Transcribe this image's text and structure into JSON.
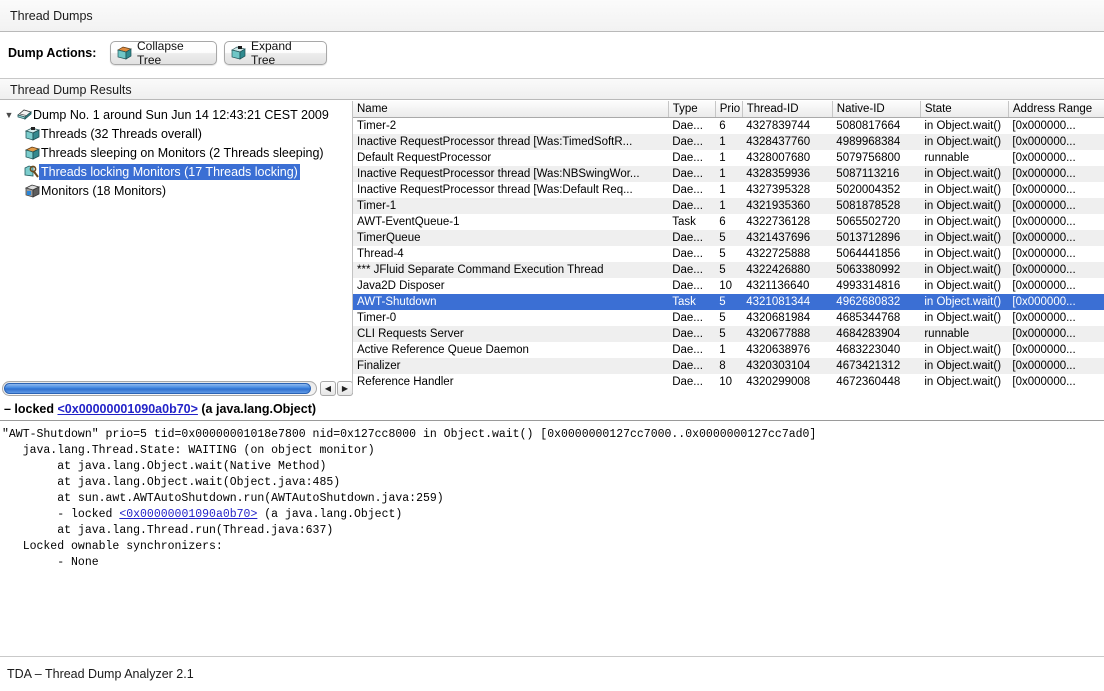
{
  "window": {
    "title": "Thread Dumps"
  },
  "toolbar": {
    "label": "Dump Actions:",
    "collapse_label": "Collapse Tree",
    "expand_label": "Expand Tree"
  },
  "results_panel": {
    "header": "Thread Dump Results"
  },
  "tree": {
    "nodes": [
      {
        "label": "Dump No. 1 around Sun Jun 14 12:43:21 CEST 2009",
        "icon": "dump-icon",
        "expanded": true,
        "twisty": "▼",
        "depth": 0,
        "selected": false
      },
      {
        "label": "Threads (32 Threads overall)",
        "icon": "threads-icon",
        "twisty": "",
        "depth": 1,
        "selected": false
      },
      {
        "label": "Threads sleeping on Monitors (2 Threads sleeping)",
        "icon": "sleeping-icon",
        "twisty": "",
        "depth": 1,
        "selected": false
      },
      {
        "label": "Threads locking Monitors (17 Threads locking)",
        "icon": "locking-icon",
        "twisty": "",
        "depth": 1,
        "selected": true
      },
      {
        "label": "Monitors (18 Monitors)",
        "icon": "monitors-icon",
        "twisty": "",
        "depth": 1,
        "selected": false
      }
    ]
  },
  "scrollbar": {
    "left_arrow": "◀",
    "right_arrow": "▶"
  },
  "table": {
    "columns": [
      "Name",
      "Type",
      "Prio",
      "Thread-ID",
      "Native-ID",
      "State",
      "Address Range"
    ],
    "rows": [
      {
        "name": "Timer-2",
        "type": "Dae...",
        "prio": "6",
        "tid": "4327839744",
        "nid": "5080817664",
        "state": "in Object.wait()",
        "addr": "[0x000000...",
        "selected": false
      },
      {
        "name": "Inactive RequestProcessor thread [Was:TimedSoftR...",
        "type": "Dae...",
        "prio": "1",
        "tid": "4328437760",
        "nid": "4989968384",
        "state": "in Object.wait()",
        "addr": "[0x000000...",
        "selected": false
      },
      {
        "name": "Default RequestProcessor",
        "type": "Dae...",
        "prio": "1",
        "tid": "4328007680",
        "nid": "5079756800",
        "state": "runnable",
        "addr": "[0x000000...",
        "selected": false
      },
      {
        "name": "Inactive RequestProcessor thread [Was:NBSwingWor...",
        "type": "Dae...",
        "prio": "1",
        "tid": "4328359936",
        "nid": "5087113216",
        "state": "in Object.wait()",
        "addr": "[0x000000...",
        "selected": false
      },
      {
        "name": "Inactive RequestProcessor thread [Was:Default Req...",
        "type": "Dae...",
        "prio": "1",
        "tid": "4327395328",
        "nid": "5020004352",
        "state": "in Object.wait()",
        "addr": "[0x000000...",
        "selected": false
      },
      {
        "name": "Timer-1",
        "type": "Dae...",
        "prio": "1",
        "tid": "4321935360",
        "nid": "5081878528",
        "state": "in Object.wait()",
        "addr": "[0x000000...",
        "selected": false
      },
      {
        "name": "AWT-EventQueue-1",
        "type": "Task",
        "prio": "6",
        "tid": "4322736128",
        "nid": "5065502720",
        "state": "in Object.wait()",
        "addr": "[0x000000...",
        "selected": false
      },
      {
        "name": "TimerQueue",
        "type": "Dae...",
        "prio": "5",
        "tid": "4321437696",
        "nid": "5013712896",
        "state": "in Object.wait()",
        "addr": "[0x000000...",
        "selected": false
      },
      {
        "name": "Thread-4",
        "type": "Dae...",
        "prio": "5",
        "tid": "4322725888",
        "nid": "5064441856",
        "state": "in Object.wait()",
        "addr": "[0x000000...",
        "selected": false
      },
      {
        "name": "*** JFluid Separate Command Execution Thread",
        "type": "Dae...",
        "prio": "5",
        "tid": "4322426880",
        "nid": "5063380992",
        "state": "in Object.wait()",
        "addr": "[0x000000...",
        "selected": false
      },
      {
        "name": "Java2D Disposer",
        "type": "Dae...",
        "prio": "10",
        "tid": "4321136640",
        "nid": "4993314816",
        "state": "in Object.wait()",
        "addr": "[0x000000...",
        "selected": false
      },
      {
        "name": "AWT-Shutdown",
        "type": "Task",
        "prio": "5",
        "tid": "4321081344",
        "nid": "4962680832",
        "state": "in Object.wait()",
        "addr": "[0x000000...",
        "selected": true
      },
      {
        "name": "Timer-0",
        "type": "Dae...",
        "prio": "5",
        "tid": "4320681984",
        "nid": "4685344768",
        "state": "in Object.wait()",
        "addr": "[0x000000...",
        "selected": false
      },
      {
        "name": "CLI Requests Server",
        "type": "Dae...",
        "prio": "5",
        "tid": "4320677888",
        "nid": "4684283904",
        "state": "runnable",
        "addr": "[0x000000...",
        "selected": false
      },
      {
        "name": "Active Reference Queue Daemon",
        "type": "Dae...",
        "prio": "1",
        "tid": "4320638976",
        "nid": "4683223040",
        "state": "in Object.wait()",
        "addr": "[0x000000...",
        "selected": false
      },
      {
        "name": "Finalizer",
        "type": "Dae...",
        "prio": "8",
        "tid": "4320303104",
        "nid": "4673421312",
        "state": "in Object.wait()",
        "addr": "[0x000000...",
        "selected": false
      },
      {
        "name": "Reference Handler",
        "type": "Dae...",
        "prio": "10",
        "tid": "4320299008",
        "nid": "4672360448",
        "state": "in Object.wait()",
        "addr": "[0x000000...",
        "selected": false
      }
    ]
  },
  "locked_line": {
    "prefix": "– locked ",
    "link": "<0x00000001090a0b70>",
    "suffix": " (a java.lang.Object)"
  },
  "stack_trace": {
    "before_link": "\"AWT-Shutdown\" prio=5 tid=0x00000001018e7800 nid=0x127cc8000 in Object.wait() [0x0000000127cc7000..0x0000000127cc7ad0]\n   java.lang.Thread.State: WAITING (on object monitor)\n        at java.lang.Object.wait(Native Method)\n        at java.lang.Object.wait(Object.java:485)\n        at sun.awt.AWTAutoShutdown.run(AWTAutoShutdown.java:259)\n        - locked ",
    "link": "<0x00000001090a0b70>",
    "after_link": " (a java.lang.Object)\n        at java.lang.Thread.run(Thread.java:637)\n   Locked ownable synchronizers:\n        - None"
  },
  "status": {
    "text": "TDA – Thread Dump Analyzer 2.1"
  },
  "colors": {
    "selection_blue": "#3b6fd4",
    "link_blue": "#2323c8",
    "row_stripe": "#efefef",
    "icon_teal": "#5fc8c8"
  }
}
